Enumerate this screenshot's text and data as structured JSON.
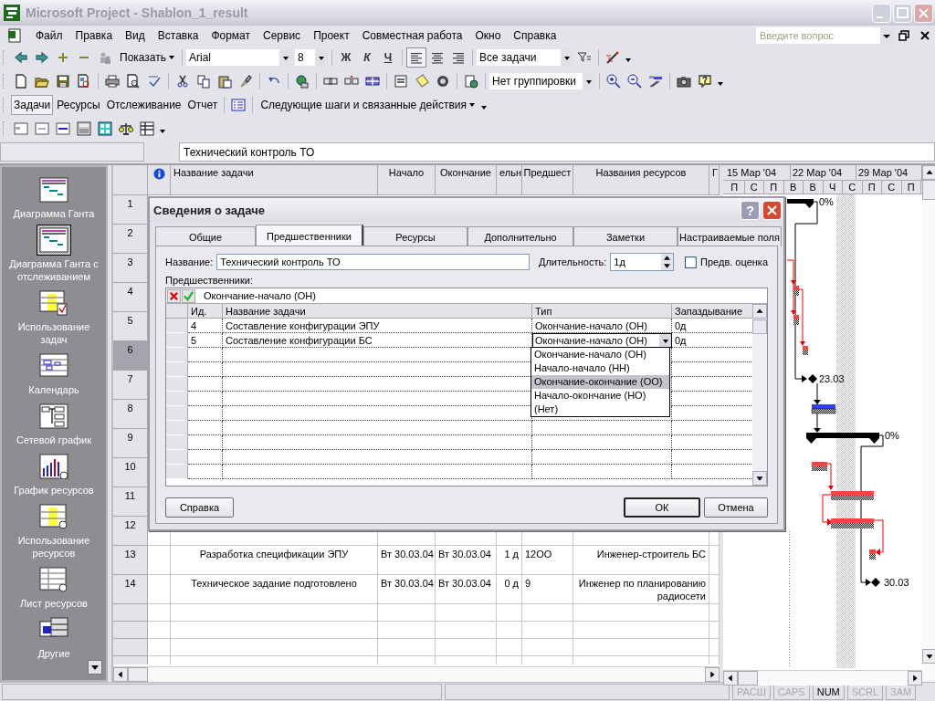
{
  "window": {
    "title": "Microsoft Project - Shablon_1_result"
  },
  "menu": [
    "Файл",
    "Правка",
    "Вид",
    "Вставка",
    "Формат",
    "Сервис",
    "Проект",
    "Совместная работа",
    "Окно",
    "Справка"
  ],
  "help_search": {
    "placeholder": "Введите вопрос"
  },
  "toolbar": {
    "show_button": "Показать",
    "font": "Arial",
    "font_size": "8",
    "format_buttons": [
      "Ж",
      "К",
      "Ч"
    ],
    "alignment_buttons": [
      {
        "selected": true
      },
      {
        "selected": false
      },
      {
        "selected": false
      }
    ],
    "filter": "Все задачи",
    "grouping": "Нет группировки"
  },
  "project_guide": {
    "tabs": [
      {
        "label": "Задачи",
        "selected": true
      },
      {
        "label": "Ресурсы",
        "selected": false
      },
      {
        "label": "Отслеживание",
        "selected": false
      },
      {
        "label": "Отчет",
        "selected": false
      }
    ],
    "guide_menu": "Следующие шаги и связанные действия"
  },
  "entry_bar": {
    "value": "Технический контроль ТО"
  },
  "view_bar": {
    "items": [
      {
        "label": "Диаграмма Ганта",
        "kind": "gantt",
        "selected": false
      },
      {
        "label": "Диаграмма Ганта с отслеживанием",
        "kind": "tracking-gantt",
        "selected": true
      },
      {
        "label": "Использование задач",
        "kind": "task-usage",
        "selected": false
      },
      {
        "label": "Календарь",
        "kind": "calendar",
        "selected": false
      },
      {
        "label": "Сетевой график",
        "kind": "network",
        "selected": false
      },
      {
        "label": "График ресурсов",
        "kind": "resource-graph",
        "selected": false
      },
      {
        "label": "Использование ресурсов",
        "kind": "resource-usage",
        "selected": false
      },
      {
        "label": "Лист ресурсов",
        "kind": "resource-sheet",
        "selected": false
      },
      {
        "label": "Другие",
        "kind": "more-views",
        "selected": false
      }
    ]
  },
  "table": {
    "columns": [
      "Название задачи",
      "Начало",
      "Окончание",
      "ельн",
      "Предшест",
      "Названия ресурсов",
      "Г"
    ],
    "rows": [
      {
        "number": "1",
        "selected": false
      },
      {
        "number": "2",
        "selected": false
      },
      {
        "number": "3",
        "selected": false
      },
      {
        "number": "4",
        "selected": false
      },
      {
        "number": "5",
        "selected": false
      },
      {
        "number": "6",
        "selected": true
      },
      {
        "number": "7",
        "selected": false
      },
      {
        "number": "8",
        "selected": false
      },
      {
        "number": "9",
        "selected": false
      },
      {
        "number": "10",
        "selected": false
      },
      {
        "number": "11",
        "selected": false
      },
      {
        "number": "12",
        "selected": false
      },
      {
        "number": "13",
        "selected": false,
        "cells": [
          "Разработка спецификации ЭПУ",
          "Вт 30.03.04",
          "Вт 30.03.04",
          "1 д",
          "12ОО",
          "Инженер-строитель БС"
        ]
      },
      {
        "number": "14",
        "selected": false,
        "cells": [
          "Техническое задание подготовлено",
          "Вт 30.03.04",
          "Вт 30.03.04",
          "0 д",
          "9",
          "Инженер по планированию радиосети"
        ]
      }
    ]
  },
  "gantt": {
    "weeks": [
      "15 Мар '04",
      "22 Мар '04",
      "29 Мар '04"
    ],
    "days": [
      "П",
      "С",
      "П",
      "В",
      "В",
      "Ч",
      "С",
      "П",
      "С",
      "П"
    ],
    "labels": [
      "0%",
      "23.03",
      "0%",
      "30.03"
    ]
  },
  "dialog": {
    "title": "Сведения о задаче",
    "help_button": "?",
    "tabs": [
      {
        "label": "Общие",
        "selected": false
      },
      {
        "label": "Предшественники",
        "selected": true
      },
      {
        "label": "Ресурсы",
        "selected": false
      },
      {
        "label": "Дополнительно",
        "selected": false
      },
      {
        "label": "Заметки",
        "selected": false
      },
      {
        "label": "Настраиваемые поля",
        "selected": false
      }
    ],
    "name_label": "Название:",
    "name_value": "Технический контроль ТО",
    "duration_label": "Длительность:",
    "duration_value": "1д",
    "estimate": {
      "label": "Предв. оценка",
      "checked": false
    },
    "predecessors_label": "Предшественники:",
    "edit_value": "Окончание-начало (ОН)",
    "grid_columns": [
      "Ид.",
      "Название задачи",
      "Тип",
      "Запаздывание"
    ],
    "grid_rows": [
      {
        "cells": [
          "4",
          "Составление конфигурации ЭПУ",
          "Окончание-начало (ОН)",
          "0д"
        ],
        "editing": false
      },
      {
        "cells": [
          "5",
          "Составление конфигурации БС",
          "Окончание-начало (ОН)",
          "0д"
        ],
        "editing": true
      }
    ],
    "type_options": [
      {
        "label": "Окончание-начало (ОН)",
        "selected": false
      },
      {
        "label": "Начало-начало (НН)",
        "selected": false
      },
      {
        "label": "Окончание-окончание (ОО)",
        "selected": true
      },
      {
        "label": "Начало-окончание (НО)",
        "selected": false
      },
      {
        "label": "(Нет)",
        "selected": false
      }
    ],
    "buttons": [
      "Справка",
      "ОК",
      "Отмена"
    ]
  },
  "status_bar": {
    "indicators": [
      {
        "label": "РАСШ",
        "on": false
      },
      {
        "label": "CAPS",
        "on": false
      },
      {
        "label": "NUM",
        "on": true
      },
      {
        "label": "SCRL",
        "on": false
      },
      {
        "label": "ЗАМ",
        "on": false
      }
    ]
  }
}
